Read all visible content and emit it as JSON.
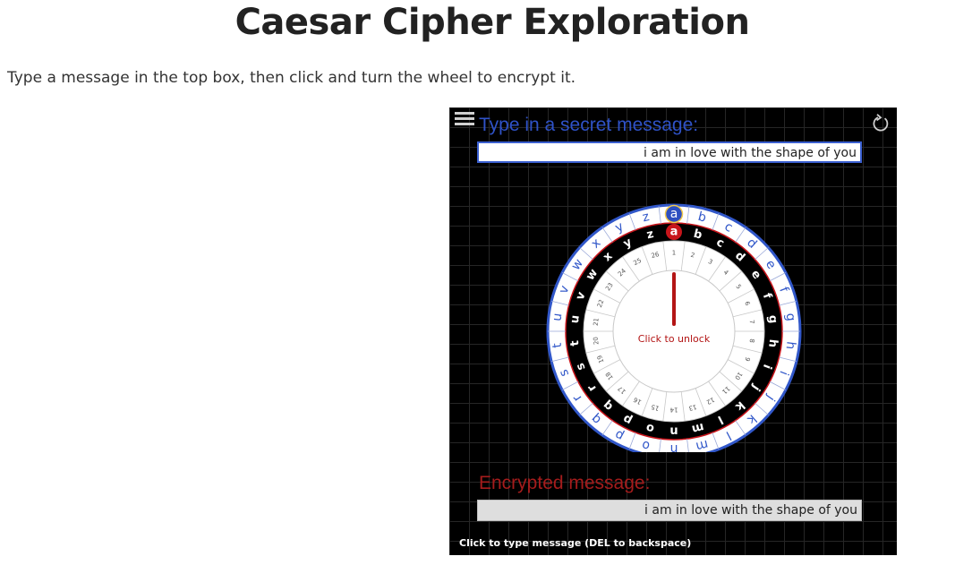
{
  "page": {
    "title": "Caesar Cipher Exploration",
    "instructions": "Type a message in the top box, then click and turn the wheel to encrypt it."
  },
  "applet": {
    "input_label": "Type in a secret message:",
    "input_value": "i am in love with the shape of you",
    "output_label": "Encrypted message:",
    "output_value": "i am in love with the shape of you",
    "lock_label": "Click to unlock",
    "footer_note": "Click to type message (DEL to backspace)",
    "shift": 0,
    "letters": [
      "a",
      "b",
      "c",
      "d",
      "e",
      "f",
      "g",
      "h",
      "i",
      "j",
      "k",
      "l",
      "m",
      "n",
      "o",
      "p",
      "q",
      "r",
      "s",
      "t",
      "u",
      "v",
      "w",
      "x",
      "y",
      "z"
    ],
    "numbers": [
      "1",
      "2",
      "3",
      "4",
      "5",
      "6",
      "7",
      "8",
      "9",
      "10",
      "11",
      "12",
      "13",
      "14",
      "15",
      "16",
      "17",
      "18",
      "19",
      "20",
      "21",
      "22",
      "23",
      "24",
      "25",
      "26"
    ],
    "colors": {
      "outer_ring_text": "#3157c9",
      "outer_ring_border": "#3157c9",
      "inner_ring_bg": "#000000",
      "inner_ring_text": "#ffffff",
      "selected_outer": "#2d4fc0",
      "selected_inner": "#c8151b",
      "pointer": "#b31515",
      "lock_text": "#b31515"
    },
    "icons": {
      "menu": "hamburger-menu-icon",
      "reset": "reset-arrow-icon"
    }
  }
}
